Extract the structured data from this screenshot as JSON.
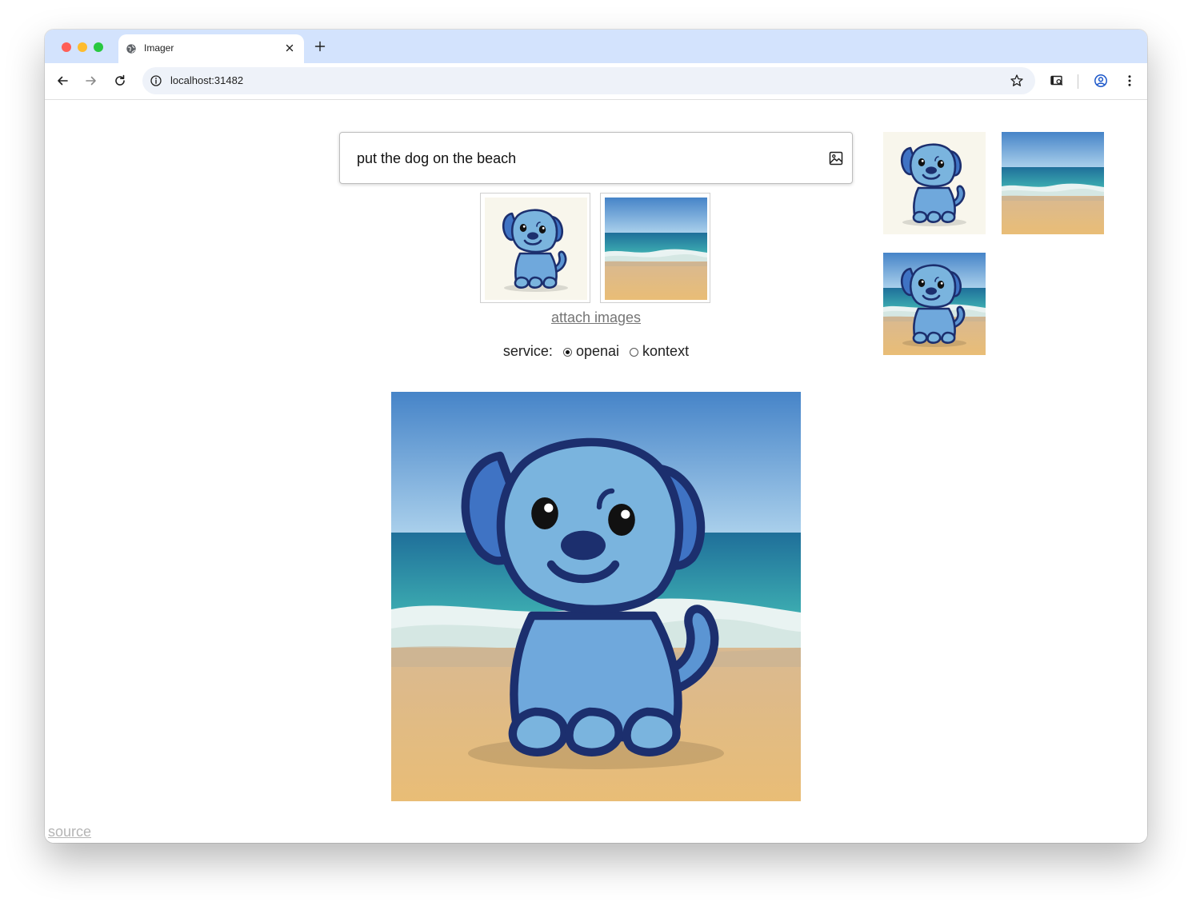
{
  "browser": {
    "tab_title": "Imager",
    "url": "localhost:31482",
    "icons": [
      "globe-icon",
      "close-icon",
      "plus-icon",
      "back-arrow-icon",
      "forward-arrow-icon",
      "reload-icon",
      "info-icon",
      "star-icon",
      "media-search-icon",
      "profile-icon",
      "kebab-menu-icon"
    ]
  },
  "prompt": {
    "text": "put the dog on the beach",
    "icon": "image-icon"
  },
  "attachments": {
    "items": [
      "blue-puppy-image",
      "beach-image"
    ],
    "link_label": "attach images"
  },
  "service": {
    "label": "service:",
    "options": [
      {
        "label": "openai",
        "selected": true
      },
      {
        "label": "kontext",
        "selected": false
      }
    ]
  },
  "result": {
    "image": "blue-puppy-on-beach-image"
  },
  "history": {
    "items": [
      "blue-puppy-image",
      "beach-image",
      "blue-puppy-on-beach-image"
    ]
  },
  "footer": {
    "source_label": "source"
  },
  "colors": {
    "tabstrip": "#d3e3fd",
    "omnibox": "#eef2f9",
    "sky_top": "#4d8dd0",
    "sea": "#2a9ab0",
    "sand": "#e6bd7c",
    "dog_blue": "#7ab4de",
    "dog_outline": "#1c2f6e"
  }
}
